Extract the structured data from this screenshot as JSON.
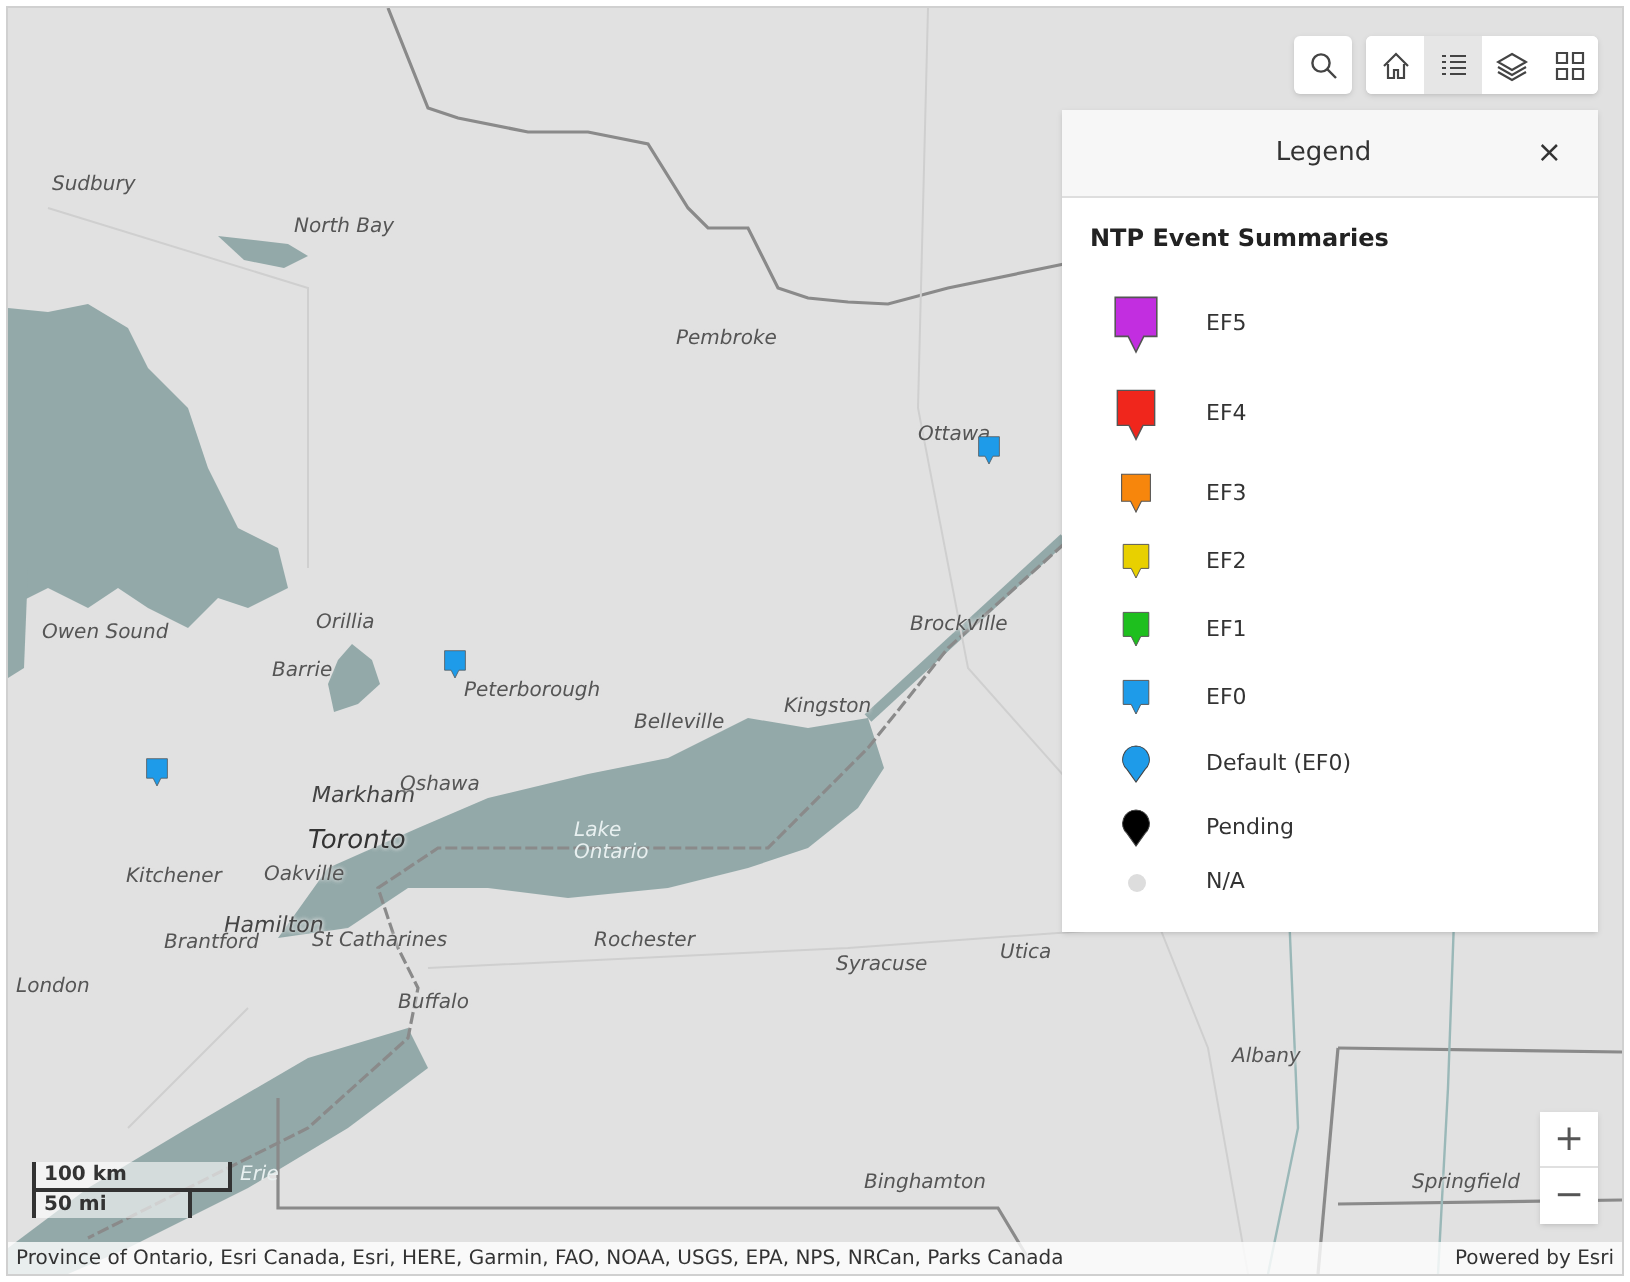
{
  "toolbar": {
    "tools": [
      {
        "kind": "home",
        "selected": false
      },
      {
        "kind": "legend",
        "selected": true
      },
      {
        "kind": "layers",
        "selected": false
      },
      {
        "kind": "basemap",
        "selected": false
      }
    ]
  },
  "map": {
    "places": [
      {
        "name": "Sudbury",
        "kind": "city"
      },
      {
        "name": "North Bay",
        "kind": "city"
      },
      {
        "name": "Pembroke",
        "kind": "city"
      },
      {
        "name": "Ottawa",
        "kind": "city"
      },
      {
        "name": "Orillia",
        "kind": "city"
      },
      {
        "name": "Owen Sound",
        "kind": "city"
      },
      {
        "name": "Barrie",
        "kind": "city"
      },
      {
        "name": "Peterborough",
        "kind": "city"
      },
      {
        "name": "Brockville",
        "kind": "city"
      },
      {
        "name": "Belleville",
        "kind": "city"
      },
      {
        "name": "Kingston",
        "kind": "city"
      },
      {
        "name": "Markham",
        "kind": "major"
      },
      {
        "name": "Oshawa",
        "kind": "city"
      },
      {
        "name": "Toronto",
        "kind": "capital"
      },
      {
        "name": "Lake",
        "kind": "water"
      },
      {
        "name": "Ontario",
        "kind": "water"
      },
      {
        "name": "Kitchener",
        "kind": "city"
      },
      {
        "name": "Oakville",
        "kind": "city"
      },
      {
        "name": "Hamilton",
        "kind": "major"
      },
      {
        "name": "Brantford",
        "kind": "city"
      },
      {
        "name": "St Catharines",
        "kind": "city"
      },
      {
        "name": "Rochester",
        "kind": "city"
      },
      {
        "name": "Syracuse",
        "kind": "city"
      },
      {
        "name": "Utica",
        "kind": "city"
      },
      {
        "name": "London",
        "kind": "city"
      },
      {
        "name": "Buffalo",
        "kind": "city"
      },
      {
        "name": "Albany",
        "kind": "city"
      },
      {
        "name": "Binghamton",
        "kind": "city"
      },
      {
        "name": "Springfield",
        "kind": "city"
      },
      {
        "name": "Erie",
        "kind": "water"
      }
    ],
    "markers": [
      {
        "color": "#1e9be9"
      },
      {
        "color": "#1e9be9"
      },
      {
        "color": "#1e9be9"
      }
    ],
    "scale": {
      "metric": "100 km",
      "imperial": "50 mi"
    },
    "zoom": {
      "in": "+",
      "out": "−"
    },
    "attribution": "Province of Ontario, Esri Canada, Esri, HERE, Garmin, FAO, NOAA, USGS, EPA, NPS, NRCan, Parks Canada",
    "powered_by": "Powered by Esri"
  },
  "legend": {
    "title": "Legend",
    "close": "×",
    "layer": "NTP Event Summaries",
    "items": [
      {
        "label": "EF5",
        "kind": "pin",
        "color": "#c22ee0"
      },
      {
        "label": "EF4",
        "kind": "pin",
        "color": "#f0261c"
      },
      {
        "label": "EF3",
        "kind": "pin",
        "color": "#f7860c"
      },
      {
        "label": "EF2",
        "kind": "pin",
        "color": "#e8d000"
      },
      {
        "label": "EF1",
        "kind": "pin",
        "color": "#1ebf1e"
      },
      {
        "label": "EF0",
        "kind": "pin",
        "color": "#1e9be9"
      },
      {
        "label": "Default (EF0)",
        "kind": "round",
        "color": "#1e9be9"
      },
      {
        "label": "Pending",
        "kind": "round",
        "color": "#000000"
      },
      {
        "label": "N/A",
        "kind": "dot",
        "color": "#dddddd"
      }
    ]
  }
}
